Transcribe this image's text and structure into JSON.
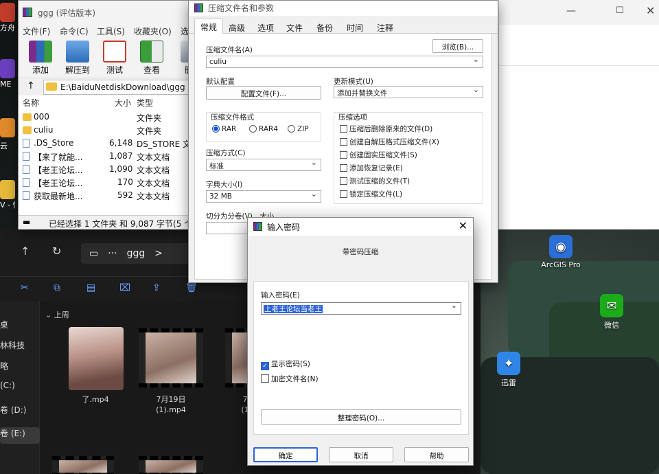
{
  "desktop": {
    "icons": [
      {
        "label": "ArcGIS Pro",
        "icon": "arcgis-icon"
      },
      {
        "label": "微信",
        "icon": "wechat-icon"
      },
      {
        "label": "迅雷",
        "icon": "thunder-icon"
      }
    ],
    "left_strip": [
      "方舟",
      "ME",
      "云",
      "V - 快"
    ]
  },
  "explorer": {
    "path": [
      "···",
      "ggg",
      ">"
    ],
    "sidebar": [
      "桌",
      "林科技",
      "略",
      "(C:)",
      "卷 (D:)",
      "卷 (E:)"
    ],
    "group_label": "上周",
    "thumbnails": [
      {
        "caption": "了.mp4"
      },
      {
        "caption": "7月19日\n(1).mp4"
      },
      {
        "caption": "7\n(1"
      }
    ]
  },
  "winrar": {
    "title": "ggg (评估版本)",
    "menu": [
      "文件(F)",
      "命令(C)",
      "工具(S)",
      "收藏夹(O)",
      "选"
    ],
    "tools": [
      "添加",
      "解压到",
      "测试",
      "查看",
      "删"
    ],
    "address": "E:\\BaiduNetdiskDownload\\ggg",
    "columns": [
      "名称",
      "大小",
      "类型"
    ],
    "files": [
      {
        "name": "..",
        "size": "",
        "type": "",
        "icon": "up"
      },
      {
        "name": "000",
        "size": "",
        "type": "文件夹",
        "icon": "folder"
      },
      {
        "name": "culiu",
        "size": "",
        "type": "文件夹",
        "icon": "folder"
      },
      {
        "name": ".DS_Store",
        "size": "6,148",
        "type": "DS_STORE 文",
        "icon": "doc"
      },
      {
        "name": "【来了就能...",
        "size": "1,087",
        "type": "文本文档",
        "icon": "doc"
      },
      {
        "name": "【老王论坛...",
        "size": "1,090",
        "type": "文本文档",
        "icon": "doc"
      },
      {
        "name": "【老王论坛...",
        "size": "170",
        "type": "文本文档",
        "icon": "doc"
      },
      {
        "name": "获取最新地...",
        "size": "592",
        "type": "文本文档",
        "icon": "doc"
      }
    ],
    "status": "已经选择 1 文件夹 和 9,087 字节(5 个"
  },
  "archive_dialog": {
    "title": "压缩文件名和参数",
    "tabs": [
      "常规",
      "高级",
      "选项",
      "文件",
      "备份",
      "时间",
      "注释"
    ],
    "archive_name_label": "压缩文件名(A)",
    "browse_label": "浏览(B)...",
    "archive_name": "culiu",
    "default_profile_label": "默认配置",
    "profile_button": "配置文件(F)...",
    "update_mode_label": "更新模式(U)",
    "update_mode": "添加并替换文件",
    "format_label": "压缩文件格式",
    "formats": [
      "RAR",
      "RAR4",
      "ZIP"
    ],
    "selected_format": "RAR",
    "options_label": "压缩选项",
    "options": [
      "压缩后删除原来的文件(D)",
      "创建自解压格式压缩文件(X)",
      "创建固实压缩文件(S)",
      "添加恢复记录(E)",
      "测试压缩的文件(T)",
      "锁定压缩文件(L)"
    ],
    "method_label": "压缩方式(C)",
    "method": "标准",
    "dict_label": "字典大小(I)",
    "dict": "32 MB",
    "split_label": "切分为分卷(V)，大小"
  },
  "password_dialog": {
    "title": "输入密码",
    "heading": "带密码压缩",
    "input_label": "输入密码(E)",
    "password": "上老王论坛当老王",
    "show_password": "显示密码(S)",
    "show_password_checked": true,
    "encrypt_names": "加密文件名(N)",
    "encrypt_names_checked": false,
    "organize_button": "整理密码(O)...",
    "ok": "确定",
    "cancel": "取消",
    "help": "帮助"
  },
  "colors": {
    "accent": "#2c62d8",
    "winrar_purple": "#7a2b8c",
    "folder": "#f0c040"
  }
}
